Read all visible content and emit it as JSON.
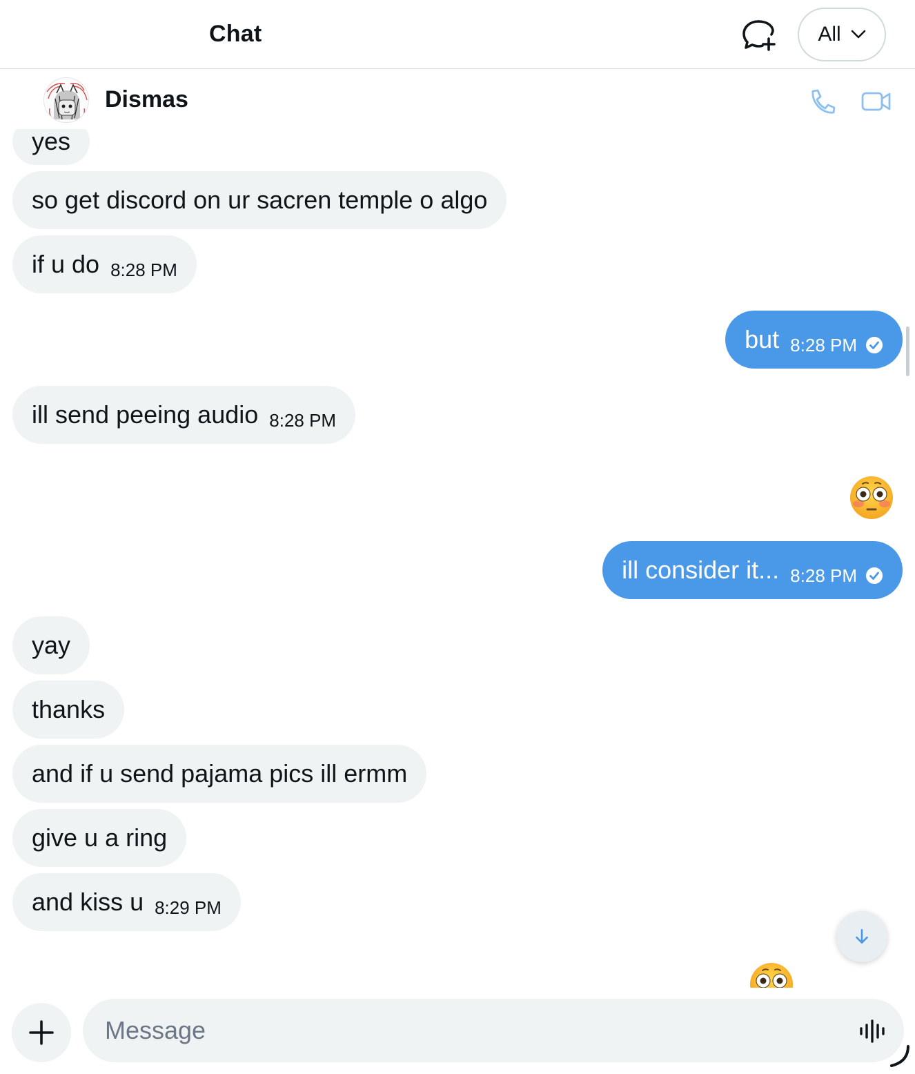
{
  "header": {
    "title": "Chat",
    "filter_label": "All",
    "new_chat_icon": "new-message-icon"
  },
  "conversation": {
    "contact_name": "Dismas",
    "call_icon": "phone-icon",
    "video_icon": "video-camera-icon",
    "accent_color": "#4a99e9"
  },
  "messages": [
    {
      "dir": "in",
      "text": "yes",
      "time": ""
    },
    {
      "dir": "in",
      "text": "so get discord on ur sacren temple o algo",
      "time": ""
    },
    {
      "dir": "in",
      "text": "if u do",
      "time": "8:28 PM"
    },
    {
      "dir": "out",
      "text": "but",
      "time": "8:28 PM",
      "read": true
    },
    {
      "dir": "in",
      "text": "ill send peeing audio",
      "time": "8:28 PM"
    },
    {
      "dir": "out",
      "emoji": "flushed-face-emoji"
    },
    {
      "dir": "out",
      "text": "ill consider it...",
      "time": "8:28 PM",
      "read": true
    },
    {
      "dir": "in",
      "text": "yay",
      "time": ""
    },
    {
      "dir": "in",
      "text": "thanks",
      "time": ""
    },
    {
      "dir": "in",
      "text": "and if u send pajama pics ill ermm",
      "time": ""
    },
    {
      "dir": "in",
      "text": "give u a ring",
      "time": ""
    },
    {
      "dir": "in",
      "text": "and kiss u",
      "time": "8:29 PM"
    },
    {
      "dir": "out",
      "emoji": "flushed-face-emoji"
    }
  ],
  "composer": {
    "placeholder": "Message",
    "add_icon": "plus-icon",
    "voice_icon": "voice-waveform-icon"
  }
}
